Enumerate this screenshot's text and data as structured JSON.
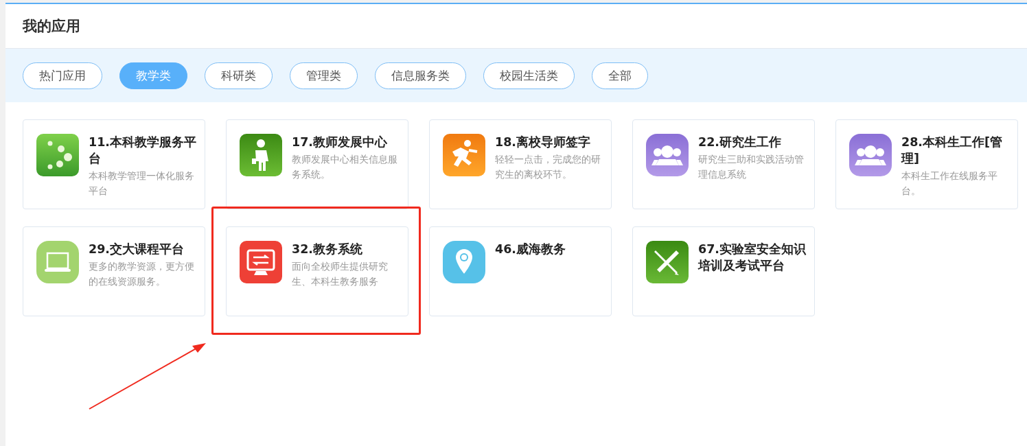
{
  "header": {
    "title": "我的应用"
  },
  "tabs": [
    {
      "label": "热门应用",
      "selected": false
    },
    {
      "label": "教学类",
      "selected": true
    },
    {
      "label": "科研类",
      "selected": false
    },
    {
      "label": "管理类",
      "selected": false
    },
    {
      "label": "信息服务类",
      "selected": false
    },
    {
      "label": "校园生活类",
      "selected": false
    },
    {
      "label": "全部",
      "selected": false
    }
  ],
  "apps": [
    {
      "title": "11.本科教学服务平台",
      "description": "本科教学管理一体化服务平台",
      "kind": "dots",
      "highlighted": false
    },
    {
      "title": "17.教师发展中心",
      "description": "教师发展中心相关信息服务系统。",
      "kind": "person",
      "highlighted": false
    },
    {
      "title": "18.离校导师签字",
      "description": "轻轻一点击，完成您的研究生的离校环节。",
      "kind": "runner",
      "highlighted": false
    },
    {
      "title": "22.研究生工作",
      "description": "研究生三助和实践活动管理信息系统",
      "kind": "group",
      "highlighted": false
    },
    {
      "title": "28.本科生工作[管理]",
      "description": "本科生工作在线服务平台。",
      "kind": "group",
      "highlighted": false
    },
    {
      "title": "29.交大课程平台",
      "description": "更多的教学资源，更方便的在线资源服务。",
      "kind": "laptop",
      "highlighted": false
    },
    {
      "title": "32.教务系统",
      "description": "面向全校师生提供研究生、本科生教务服务",
      "kind": "monitor",
      "highlighted": true
    },
    {
      "title": "46.威海教务",
      "kind": "pin",
      "highlighted": false
    },
    {
      "title": "67.实验室安全知识培训及考试平台",
      "kind": "tools",
      "highlighted": false
    }
  ]
}
